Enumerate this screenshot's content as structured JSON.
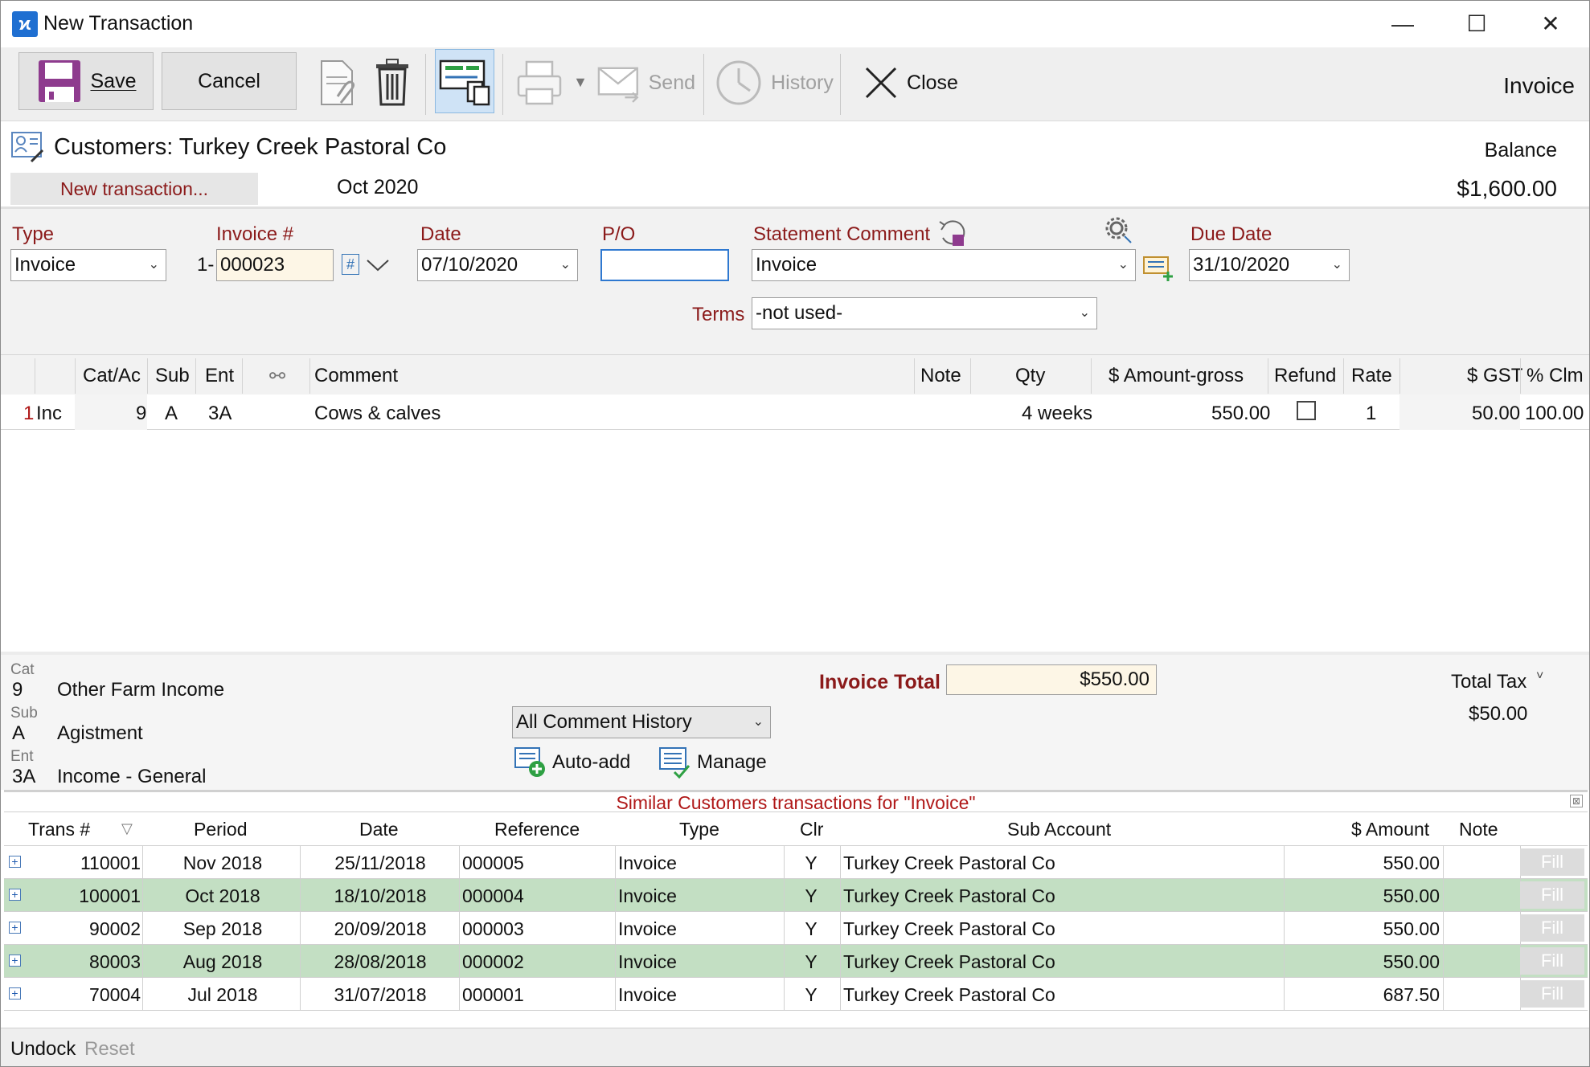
{
  "window": {
    "title": "New Transaction",
    "minimize": "—",
    "maximize": "☐",
    "close": "✕"
  },
  "toolbar": {
    "save_label": "Save",
    "cancel_label": "Cancel",
    "send_label": "Send",
    "history_label": "History",
    "close_label": "Close",
    "doc_type": "Invoice"
  },
  "header": {
    "customer": "Customers: Turkey Creek Pastoral Co",
    "new_transaction": "New transaction...",
    "period": "Oct 2020",
    "balance_label": "Balance",
    "balance_value": "$1,600.00"
  },
  "form": {
    "type_label": "Type",
    "type_value": "Invoice",
    "invoice_label": "Invoice #",
    "invoice_prefix": "1-",
    "invoice_value": "000023",
    "hash_label": "#",
    "date_label": "Date",
    "date_value": "07/10/2020",
    "po_label": "P/O",
    "po_value": "",
    "statement_label": "Statement Comment",
    "statement_value": "Invoice",
    "due_label": "Due Date",
    "due_value": "31/10/2020",
    "terms_label": "Terms",
    "terms_value": "-not used-"
  },
  "grid": {
    "headers": {
      "cat": "Cat/Ac",
      "sub": "Sub",
      "ent": "Ent",
      "link": "⚯",
      "comment": "Comment",
      "note": "Note",
      "qty": "Qty",
      "amount": "$ Amount-gross",
      "refund": "Refund",
      "rate": "Rate",
      "gst": "$ GST",
      "clm": "% Clm"
    },
    "row": {
      "num": "1",
      "type": "Inc",
      "cat": "9",
      "sub": "A",
      "ent": "3A",
      "comment": "Cows & calves",
      "qty": "4 weeks",
      "amount": "550.00",
      "rate": "1",
      "gst": "50.00",
      "clm": "100.00"
    }
  },
  "info": {
    "cat_label": "Cat",
    "cat_code": "9",
    "cat_name": "Other Farm Income",
    "sub_label": "Sub",
    "sub_code": "A",
    "sub_name": "Agistment",
    "ent_label": "Ent",
    "ent_code": "3A",
    "ent_name": "Income - General",
    "comment_history": "All Comment History",
    "auto_add": "Auto-add",
    "manage": "Manage",
    "invoice_total_label": "Invoice Total",
    "invoice_total_value": "$550.00",
    "total_tax_label": "Total Tax",
    "total_tax_value": "$50.00"
  },
  "similar": {
    "title": "Similar Customers transactions for \"Invoice\"",
    "headers": {
      "trans": "Trans #",
      "period": "Period",
      "date": "Date",
      "reference": "Reference",
      "type": "Type",
      "clr": "Clr",
      "sub_account": "Sub Account",
      "amount": "$ Amount",
      "note": "Note"
    },
    "fill_label": "Fill",
    "highlight_color": "#c3dfc3",
    "rows": [
      {
        "trans": "110001",
        "period": "Nov 2018",
        "date": "25/11/2018",
        "reference": "000005",
        "type": "Invoice",
        "clr": "Y",
        "sub_account": "Turkey Creek Pastoral Co",
        "amount": "550.00",
        "highlight": false
      },
      {
        "trans": "100001",
        "period": "Oct 2018",
        "date": "18/10/2018",
        "reference": "000004",
        "type": "Invoice",
        "clr": "Y",
        "sub_account": "Turkey Creek Pastoral Co",
        "amount": "550.00",
        "highlight": true
      },
      {
        "trans": "90002",
        "period": "Sep 2018",
        "date": "20/09/2018",
        "reference": "000003",
        "type": "Invoice",
        "clr": "Y",
        "sub_account": "Turkey Creek Pastoral Co",
        "amount": "550.00",
        "highlight": false
      },
      {
        "trans": "80003",
        "period": "Aug 2018",
        "date": "28/08/2018",
        "reference": "000002",
        "type": "Invoice",
        "clr": "Y",
        "sub_account": "Turkey Creek Pastoral Co",
        "amount": "550.00",
        "highlight": true
      },
      {
        "trans": "70004",
        "period": "Jul 2018",
        "date": "31/07/2018",
        "reference": "000001",
        "type": "Invoice",
        "clr": "Y",
        "sub_account": "Turkey Creek Pastoral Co",
        "amount": "687.50",
        "highlight": false
      }
    ]
  },
  "status": {
    "undock": "Undock",
    "reset": "Reset"
  },
  "colors": {
    "label_red": "#8b1a1a",
    "title_red": "#b01818",
    "invoice_bg": "#fdf6e6"
  }
}
